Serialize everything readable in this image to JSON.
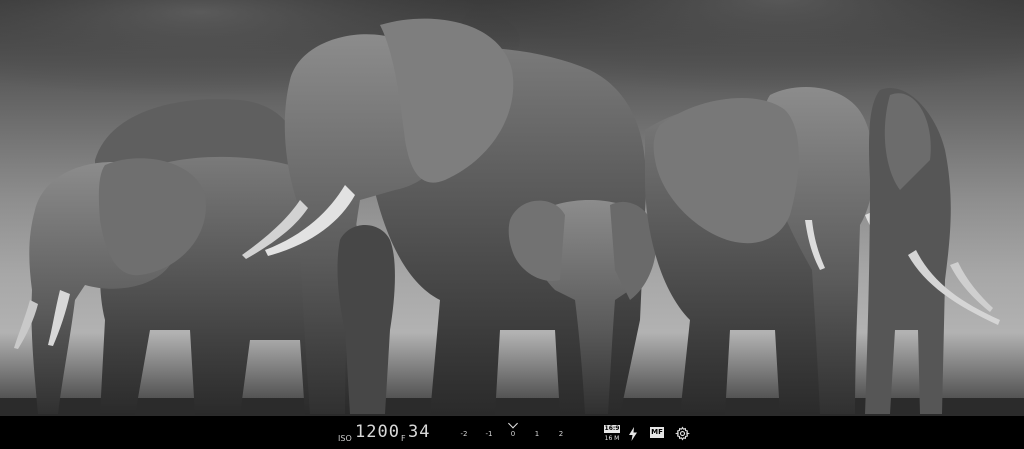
{
  "viewfinder": {
    "subject": "elephant-herd-photo"
  },
  "controls": {
    "iso_label": "ISO",
    "iso_value": "1200",
    "aperture_label": "F",
    "aperture_value": "34",
    "exposure_scale": [
      "-2",
      "-1",
      "0",
      "1",
      "2"
    ],
    "exposure_value": 0,
    "aspect_ratio": "16:9",
    "megapixels": "16 M",
    "flash_icon": "lightning-bolt-icon",
    "focus_mode": "MF",
    "settings_icon": "gear-icon"
  },
  "colors": {
    "bar_background": "#000000",
    "control_text": "#e6e6e6"
  }
}
